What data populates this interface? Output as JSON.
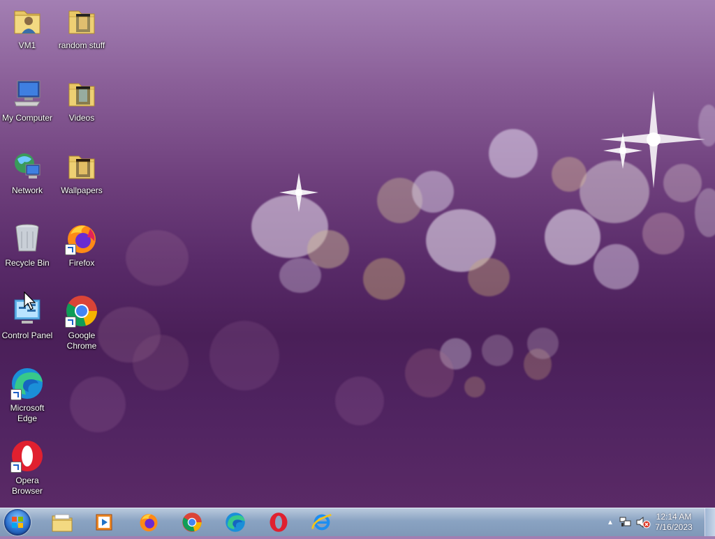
{
  "desktop_icons": [
    {
      "label": "VM1",
      "icon": "user-folder-icon"
    },
    {
      "label": "random stuff",
      "icon": "folder-icon"
    },
    {
      "label": "My Computer",
      "icon": "computer-icon"
    },
    {
      "label": "Videos",
      "icon": "folder-icon"
    },
    {
      "label": "Network",
      "icon": "network-icon"
    },
    {
      "label": "Wallpapers",
      "icon": "folder-icon"
    },
    {
      "label": "Recycle Bin",
      "icon": "recycle-bin-icon"
    },
    {
      "label": "Firefox",
      "icon": "firefox-icon"
    },
    {
      "label": "Control Panel",
      "icon": "control-panel-icon"
    },
    {
      "label": "Google Chrome",
      "icon": "chrome-icon"
    },
    {
      "label": "Microsoft Edge",
      "icon": "edge-icon"
    },
    {
      "label": "Opera Browser",
      "icon": "opera-icon"
    }
  ],
  "taskbar": {
    "pinned": [
      {
        "name": "file-explorer",
        "icon": "folder-icon"
      },
      {
        "name": "media-player",
        "icon": "media-player-icon"
      },
      {
        "name": "firefox",
        "icon": "firefox-icon"
      },
      {
        "name": "chrome",
        "icon": "chrome-icon"
      },
      {
        "name": "edge",
        "icon": "edge-icon"
      },
      {
        "name": "opera",
        "icon": "opera-icon"
      },
      {
        "name": "internet-explorer",
        "icon": "ie-icon"
      }
    ],
    "clock": {
      "time": "12:14 AM",
      "date": "7/16/2023"
    }
  },
  "colors": {
    "wallpaper_top": "#a37fb3",
    "wallpaper_bottom": "#5a2a66",
    "taskbar": "#8aa3c2"
  }
}
